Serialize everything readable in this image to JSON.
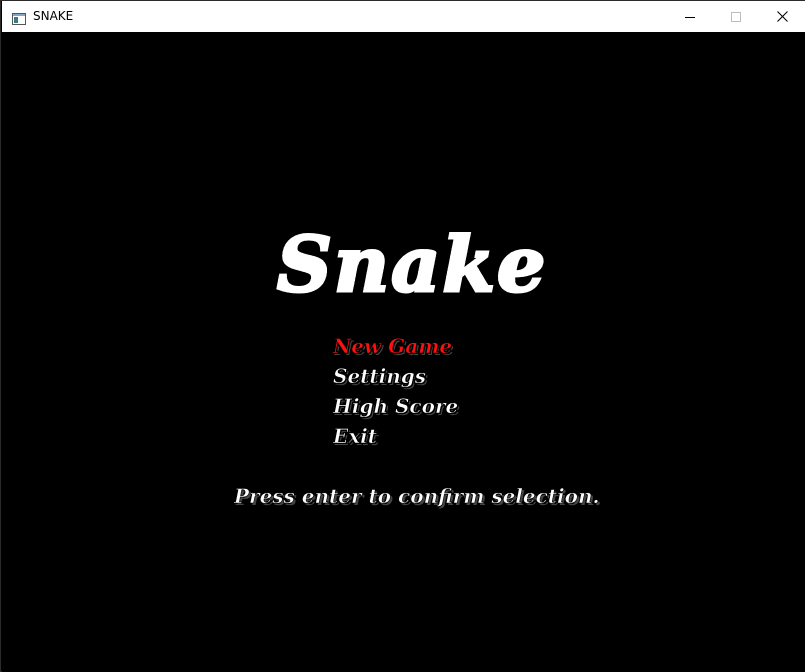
{
  "window": {
    "title": "SNAKE",
    "icon": "window-app-icon",
    "controls": {
      "minimize_icon": "minimize-icon",
      "maximize_icon": "maximize-icon",
      "close_icon": "close-icon"
    }
  },
  "game": {
    "logo_text": "Snake",
    "menu": {
      "selected_index": 0,
      "items": [
        {
          "label": "New Game",
          "selected": true
        },
        {
          "label": "Settings",
          "selected": false
        },
        {
          "label": "High Score",
          "selected": false
        },
        {
          "label": "Exit",
          "selected": false
        }
      ]
    },
    "hint": "Press enter to confirm selection."
  },
  "colors": {
    "background": "#000000",
    "text": "#ffffff",
    "selected": "#ff1010",
    "titlebar": "#ffffff"
  }
}
